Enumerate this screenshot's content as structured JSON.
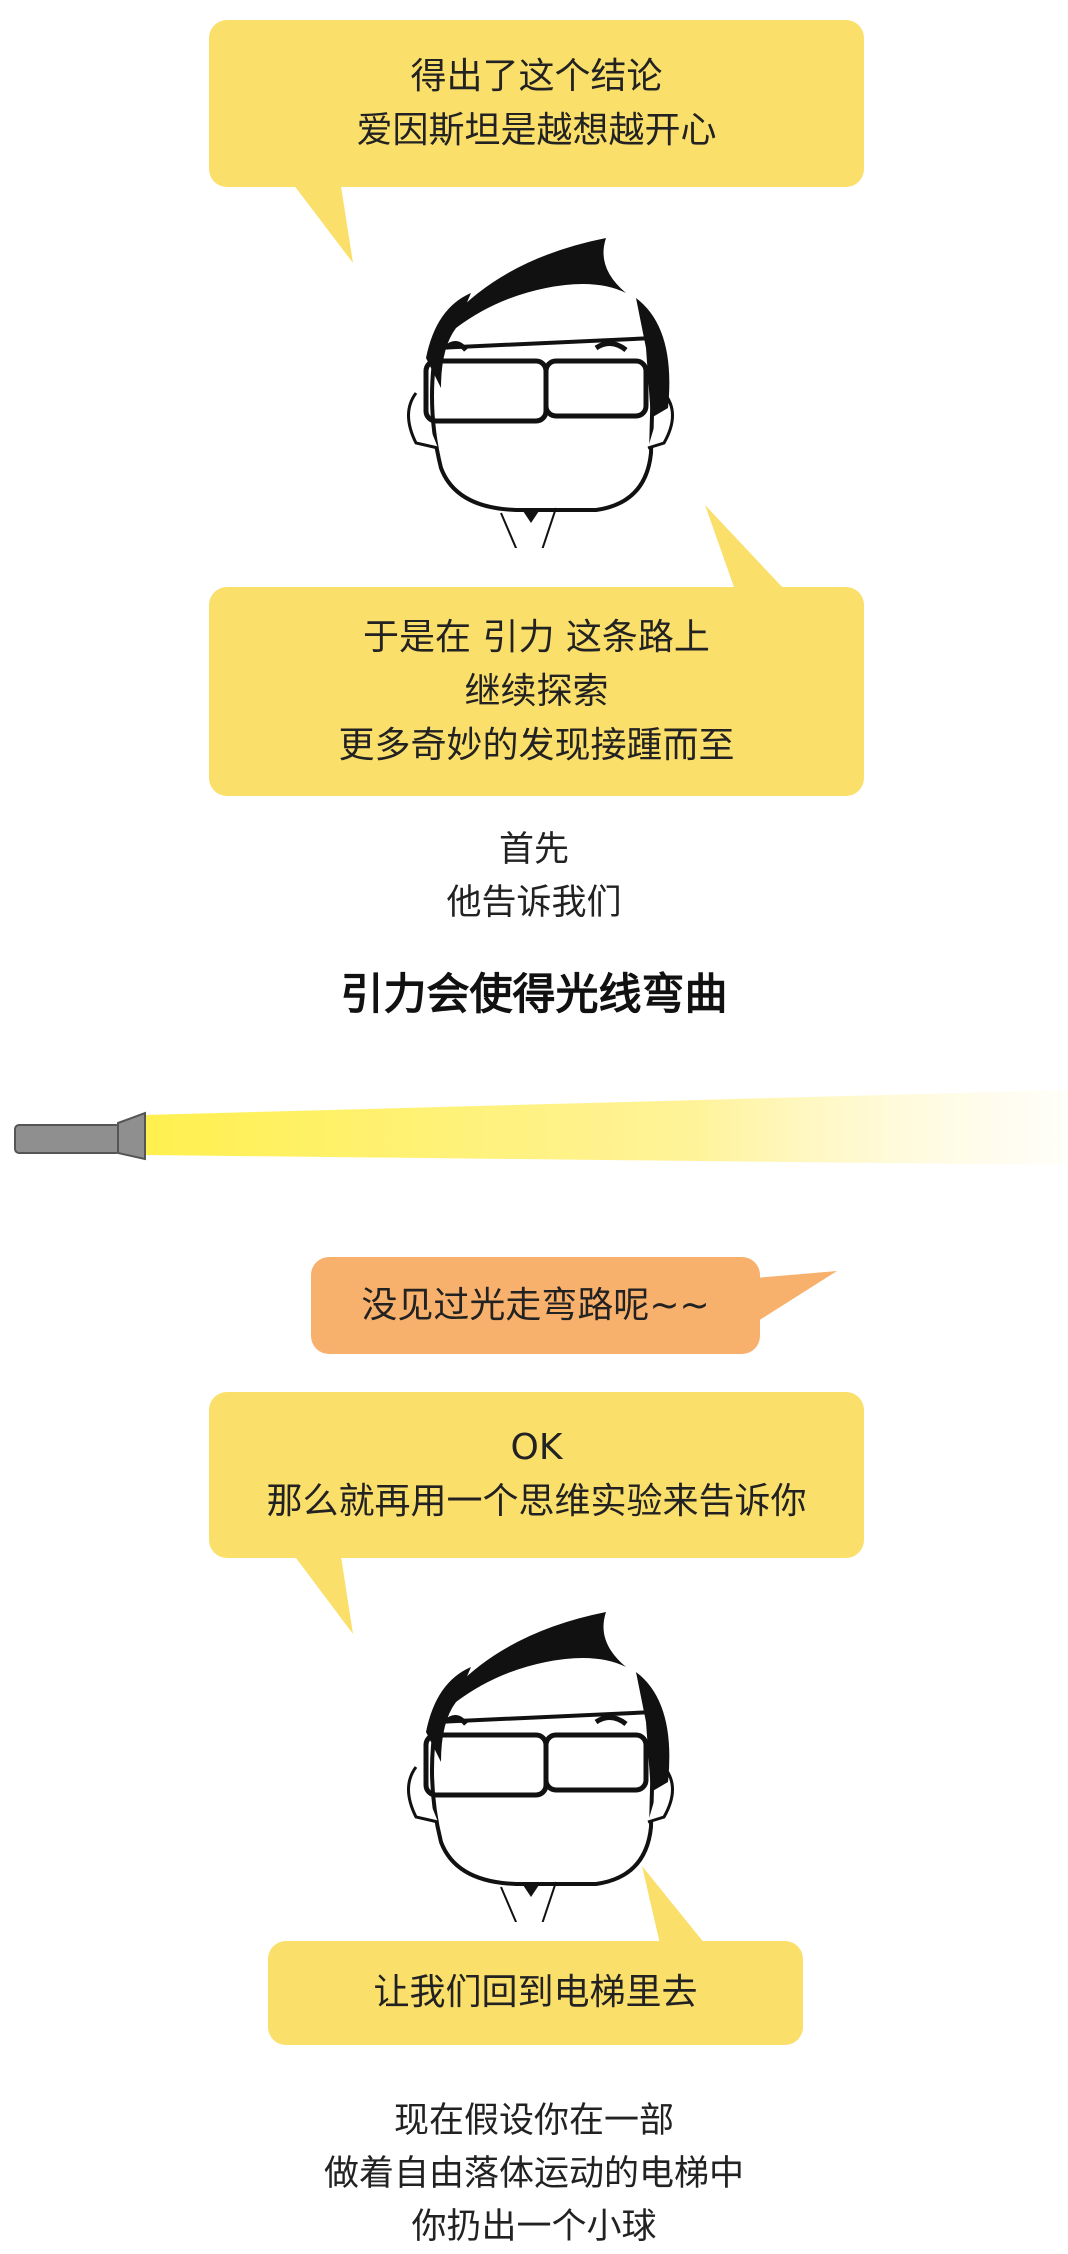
{
  "colors": {
    "bubble_yellow": "#fbdf6b",
    "bubble_orange": "#f8b16c",
    "beam": "#fff06a",
    "flashlight": "#8f8f8f"
  },
  "bubble1": {
    "lines": [
      "得出了这个结论",
      "爱因斯坦是越想越开心"
    ]
  },
  "bubble2": {
    "lines": [
      "于是在 引力 这条路上",
      "继续探索",
      "更多奇妙的发现接踵而至"
    ]
  },
  "narration1": {
    "lines": [
      "首先",
      "他告诉我们"
    ]
  },
  "headline": "引力会使得光线弯曲",
  "bubble_orange": {
    "text": "没见过光走弯路呢~~"
  },
  "bubble3": {
    "lines": [
      "OK",
      "那么就再用一个思维实验来告诉你"
    ]
  },
  "bubble4": {
    "text": "让我们回到电梯里去"
  },
  "narration2": {
    "lines": [
      "现在假设你在一部",
      "做着自由落体运动的电梯中",
      "你扔出一个小球"
    ]
  },
  "icons": [
    "cartoon-face-icon",
    "flashlight-icon"
  ]
}
